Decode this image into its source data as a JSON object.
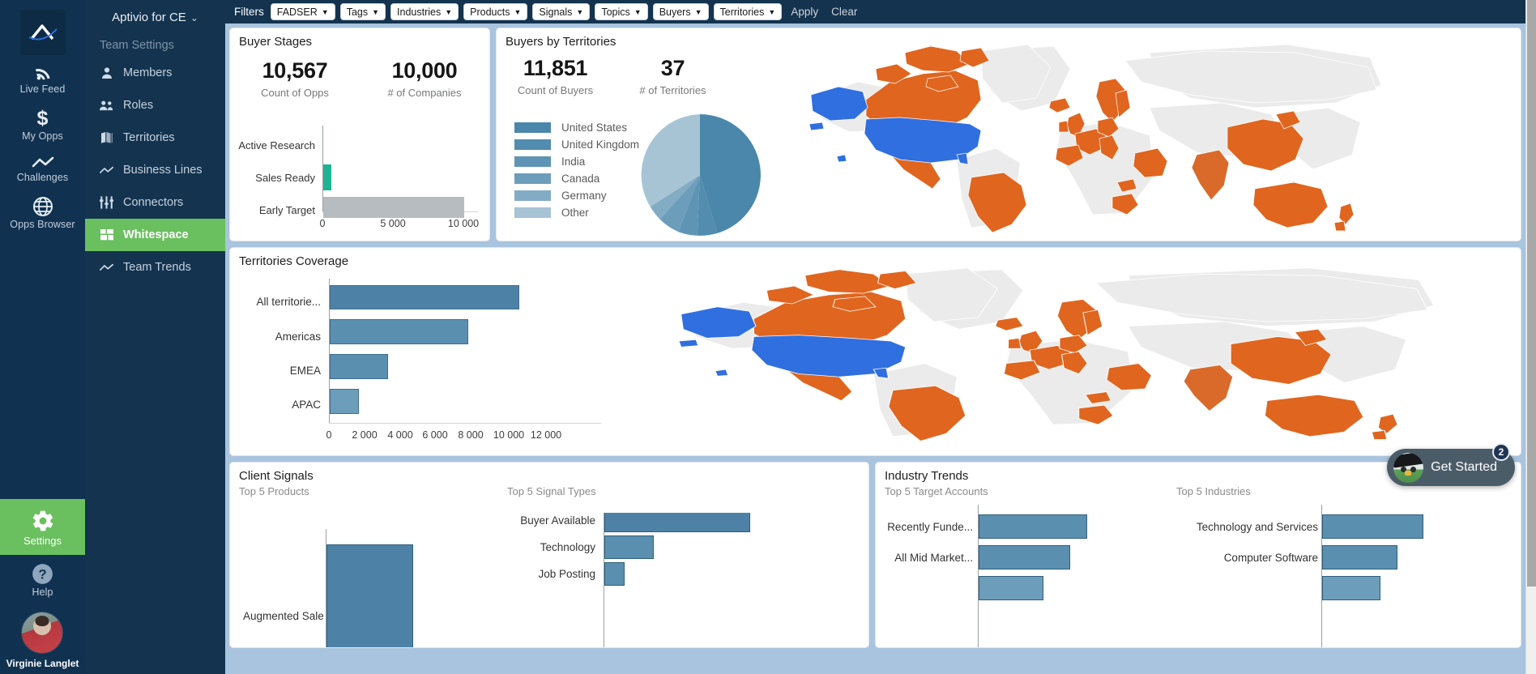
{
  "rail": {
    "logo_icon": "aptivio-logo-icon",
    "items": [
      {
        "label": "Live Feed",
        "icon": "rss-icon"
      },
      {
        "label": "My Opps",
        "icon": "dollar-icon"
      },
      {
        "label": "Challenges",
        "icon": "trend-line-icon"
      },
      {
        "label": "Opps Browser",
        "icon": "globe-icon"
      }
    ],
    "settings": {
      "label": "Settings",
      "icon": "gear-icon"
    },
    "help": {
      "label": "Help",
      "icon": "question-circle-icon"
    },
    "user": {
      "name": "Virginie Langlet"
    }
  },
  "nav": {
    "title": "Aptivio for CE",
    "chevron": "⌄",
    "section": "Team Settings",
    "items": [
      {
        "label": "Members",
        "icon": "person-icon",
        "active": false
      },
      {
        "label": "Roles",
        "icon": "people-icon",
        "active": false
      },
      {
        "label": "Territories",
        "icon": "book-map-icon",
        "active": false
      },
      {
        "label": "Business Lines",
        "icon": "trend-line-icon",
        "active": false
      },
      {
        "label": "Connectors",
        "icon": "sliders-icon",
        "active": false
      },
      {
        "label": "Whitespace",
        "icon": "grid-icon",
        "active": true
      },
      {
        "label": "Team Trends",
        "icon": "trend-line-icon",
        "active": false
      }
    ]
  },
  "filters": {
    "label": "Filters",
    "buttons": [
      {
        "label": "FADSER"
      },
      {
        "label": "Tags"
      },
      {
        "label": "Industries"
      },
      {
        "label": "Products"
      },
      {
        "label": "Signals"
      },
      {
        "label": "Topics"
      },
      {
        "label": "Buyers"
      },
      {
        "label": "Territories"
      }
    ],
    "caret": "▼",
    "apply": "Apply",
    "clear": "Clear"
  },
  "colors": {
    "accent_green": "#6abf5e",
    "nav_dark": "#13334f",
    "rail_dark": "#103250",
    "bar_blue": "#5b8fb0",
    "bar_blue_dark": "#4d82a6",
    "bar_gray": "#b7bcc0",
    "bar_teal": "#1eb493",
    "map_orange": "#e0651f",
    "map_blue": "#2f6fe0",
    "map_gray": "#ebebeb",
    "board_bg": "#a9c4de"
  },
  "cards": {
    "buyer_stages": {
      "title": "Buyer Stages",
      "kpis": [
        {
          "value": "10,567",
          "caption": "Count of Opps"
        },
        {
          "value": "10,000",
          "caption": "# of Companies"
        }
      ]
    },
    "buyers_by_territories": {
      "title": "Buyers by Territories",
      "kpis": [
        {
          "value": "11,851",
          "caption": "Count of Buyers"
        },
        {
          "value": "37",
          "caption": "# of Territories"
        }
      ]
    },
    "territories_coverage": {
      "title": "Territories Coverage"
    },
    "client_signals": {
      "title": "Client Signals",
      "sub_left": "Top 5 Products",
      "sub_right": "Top 5 Signal Types"
    },
    "industry_trends": {
      "title": "Industry Trends",
      "sub_left": "Top 5 Target Accounts",
      "sub_right": "Top 5 Industries"
    }
  },
  "get_started": {
    "label": "Get Started",
    "badge": "2",
    "icon": "owl-graduate-icon"
  },
  "chart_data": [
    {
      "id": "buyer_stages_bar",
      "type": "bar",
      "orientation": "horizontal",
      "title": "Buyer Stages",
      "categories": [
        "Active Research",
        "Sales Ready",
        "Early Target"
      ],
      "values": [
        0,
        567,
        10000
      ],
      "colors": [
        "#1eb493",
        "#1eb493",
        "#b7bcc0"
      ],
      "xlabel": "",
      "ylabel": "",
      "xlim": [
        0,
        11000
      ],
      "tick_values": [
        0,
        5000,
        10000
      ],
      "tick_labels": [
        "0",
        "5 000",
        "10 000"
      ],
      "grid": false
    },
    {
      "id": "buyers_by_territories_pie",
      "type": "pie",
      "title": "Buyers by Territories",
      "categories": [
        "United States",
        "United Kingdom",
        "India",
        "Canada",
        "Germany",
        "Other"
      ],
      "values": [
        46.5,
        7.5,
        6.0,
        5.5,
        3.0,
        31.5
      ],
      "colors": [
        "#4a87ab",
        "#528cae",
        "#5e95b4",
        "#6c9dba",
        "#82acc4",
        "#a6c4d4"
      ],
      "legend_position": "left"
    },
    {
      "id": "territories_coverage_bar",
      "type": "bar",
      "orientation": "horizontal",
      "title": "Territories Coverage",
      "categories": [
        "All territorie...",
        "Americas",
        "EMEA",
        "APAC"
      ],
      "values": [
        10500,
        7700,
        3250,
        1600
      ],
      "color": "#5b8fb0",
      "xlim": [
        0,
        12000
      ],
      "tick_values": [
        0,
        2000,
        4000,
        6000,
        8000,
        10000,
        12000
      ],
      "tick_labels": [
        "0",
        "2 000",
        "4 000",
        "6 000",
        "8 000",
        "10 000",
        "12 000"
      ],
      "grid": false
    },
    {
      "id": "top5_products_bar",
      "type": "bar",
      "orientation": "vertical",
      "title": "Top 5 Products",
      "categories": [
        "Augmented Sale"
      ],
      "values": [
        100
      ],
      "color": "#5b8fb0"
    },
    {
      "id": "top5_signal_types_bar",
      "type": "bar",
      "orientation": "horizontal",
      "title": "Top 5 Signal Types",
      "categories": [
        "Buyer Available",
        "Technology",
        "Job Posting"
      ],
      "values": [
        100,
        34,
        14
      ],
      "color": "#5b8fb0"
    },
    {
      "id": "top5_target_accounts_bar",
      "type": "bar",
      "orientation": "horizontal",
      "title": "Top 5 Target Accounts",
      "categories": [
        "Recently Funde...",
        "All Mid Market...",
        ""
      ],
      "values": [
        100,
        84,
        60
      ],
      "color": "#5b8fb0"
    },
    {
      "id": "top5_industries_bar",
      "type": "bar",
      "orientation": "horizontal",
      "title": "Top 5 Industries",
      "categories": [
        "Technology and Services",
        "Computer Software",
        ""
      ],
      "values": [
        100,
        64,
        53
      ],
      "color": "#5b8fb0"
    },
    {
      "id": "buyers_world_map",
      "type": "map",
      "title": "Buyers by Territories map",
      "highlight_primary_color": "#2f6fe0",
      "highlight_secondary_color": "#e0651f",
      "base_color": "#ebebeb"
    },
    {
      "id": "coverage_world_map",
      "type": "map",
      "title": "Territories Coverage map",
      "highlight_primary_color": "#2f6fe0",
      "highlight_secondary_color": "#e0651f",
      "base_color": "#ebebeb"
    }
  ]
}
